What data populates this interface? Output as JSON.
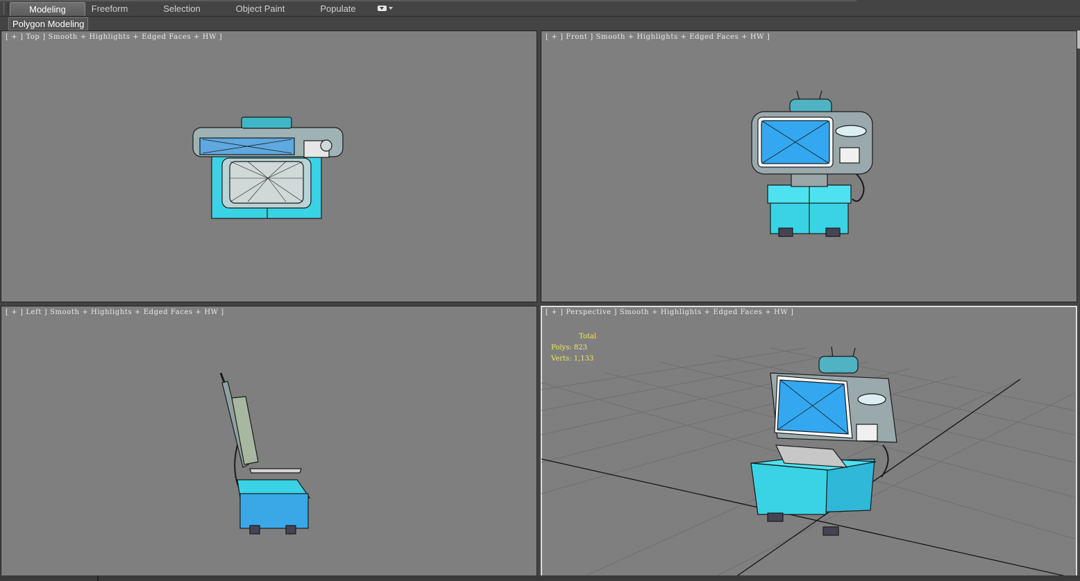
{
  "ribbon": {
    "tabs": [
      {
        "label": "Modeling",
        "active": true
      },
      {
        "label": "Freeform",
        "active": false
      },
      {
        "label": "Selection",
        "active": false
      },
      {
        "label": "Object Paint",
        "active": false
      },
      {
        "label": "Populate",
        "active": false
      }
    ]
  },
  "panel": {
    "label": "Polygon Modeling"
  },
  "viewports": {
    "top": {
      "label": "[ + ] Top ] Smooth + Highlights + Edged Faces + HW ]"
    },
    "front": {
      "label": "[ + ] Front ] Smooth + Highlights + Edged Faces + HW ]"
    },
    "left": {
      "label": "[ + ] Left ] Smooth + Highlights + Edged Faces + HW ]"
    },
    "perspective": {
      "label": "[ + ] Perspective ] Smooth + Highlights + Edged Faces + HW ]",
      "stats": {
        "total_label": "Total",
        "polys": "Polys: 823",
        "verts": "Verts: 1,133"
      }
    }
  },
  "colors": {
    "viewport_bg": "#7f7f7f",
    "model_cyan": "#3ad3e6",
    "screen_blue": "#33a8f0",
    "stats_yellow": "#f2e85a"
  }
}
